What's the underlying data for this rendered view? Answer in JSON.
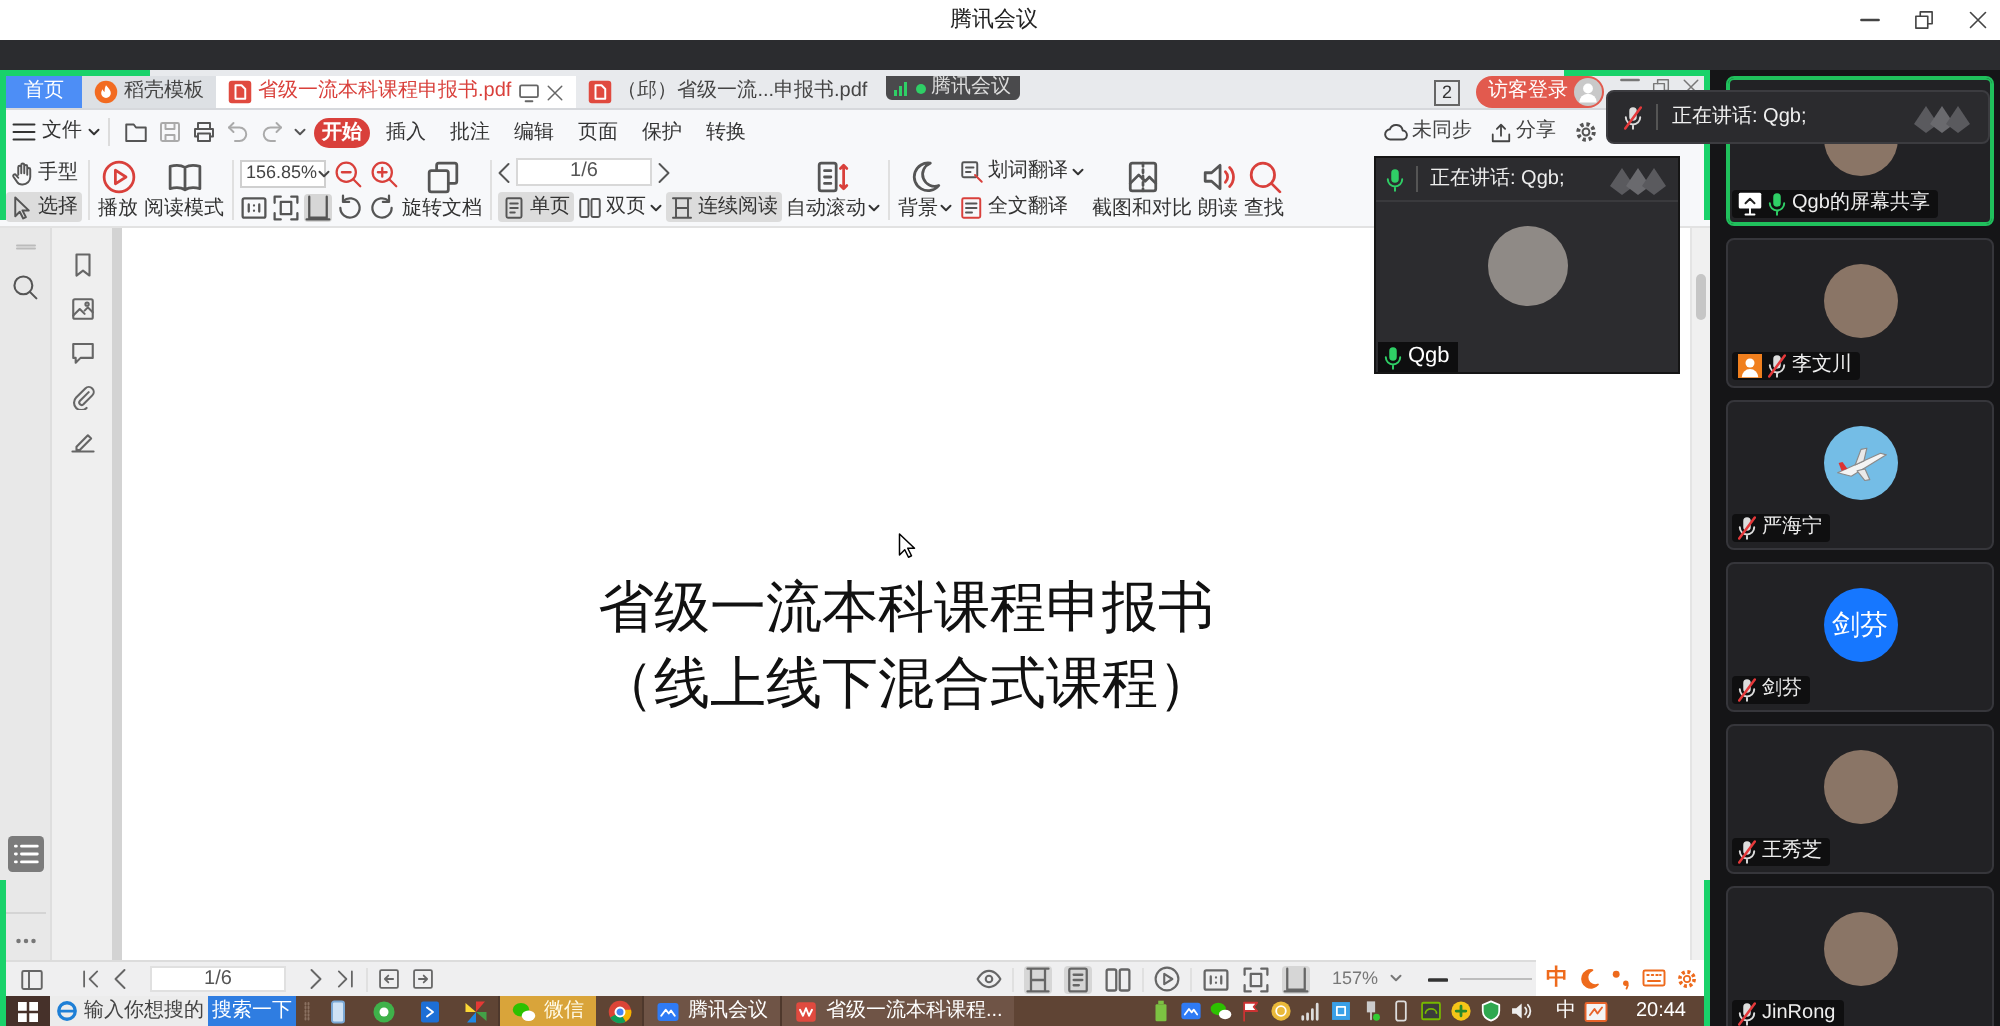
{
  "window": {
    "title": "腾讯会议"
  },
  "meeting_badge": {
    "label": "腾讯会议"
  },
  "wps": {
    "tabs": [
      {
        "kind": "home",
        "label": "首页",
        "selected": false
      },
      {
        "kind": "template",
        "label": "稻壳模板",
        "selected": false
      },
      {
        "kind": "pdf",
        "label": "省级一流本科课程申报书.pdf",
        "selected": true
      },
      {
        "kind": "pdf",
        "label": "（邱）省级一流...申报书.pdf",
        "selected": false
      }
    ],
    "window_count": "2",
    "login": "访客登录",
    "file_menu": "文件",
    "ribbon_tabs": [
      {
        "label": "开始",
        "selected": true
      },
      {
        "label": "插入",
        "selected": false
      },
      {
        "label": "批注",
        "selected": false
      },
      {
        "label": "编辑",
        "selected": false
      },
      {
        "label": "页面",
        "selected": false
      },
      {
        "label": "保护",
        "selected": false
      },
      {
        "label": "转换",
        "selected": false
      }
    ],
    "sync": "未同步",
    "share": "分享",
    "tools": {
      "hand": {
        "label": "手型",
        "selected": false
      },
      "select": {
        "label": "选择",
        "selected": true
      },
      "play": "播放",
      "read_mode": "阅读模式",
      "zoom": "156.85%",
      "fit_modes": [
        {
          "kind": "actual",
          "selected": false
        },
        {
          "kind": "fit-page",
          "selected": false
        },
        {
          "kind": "fit-width",
          "selected": true
        }
      ],
      "rotate": "旋转文档",
      "page": "1/6",
      "page_modes": [
        {
          "kind": "single",
          "label": "单页",
          "selected": true,
          "dropdown": false
        },
        {
          "kind": "double",
          "label": "双页",
          "selected": false,
          "dropdown": true
        },
        {
          "kind": "continuous",
          "label": "连续阅读",
          "selected": true,
          "dropdown": false
        }
      ],
      "auto_scroll": "自动滚动",
      "background": "背景",
      "word_translate": "划词翻译",
      "full_translate": "全文翻译",
      "screenshot_compare": "截图和对比",
      "read_aloud": "朗读",
      "find": "查找"
    },
    "document": {
      "title": "省级一流本科课程申报书",
      "subtitle": "（线上线下混合式课程）"
    },
    "status_bar": {
      "page": "1/6",
      "view_modes": [
        {
          "kind": "continuous",
          "selected": true
        },
        {
          "kind": "single",
          "selected": true
        },
        {
          "kind": "double",
          "selected": false
        }
      ],
      "fit_modes": [
        {
          "kind": "actual",
          "selected": false
        },
        {
          "kind": "fit-page",
          "selected": false
        },
        {
          "kind": "fit-width",
          "selected": true
        }
      ],
      "zoom": "157%"
    }
  },
  "ime": {
    "mode": "中"
  },
  "taskbar": {
    "search_placeholder": "输入你想搜的",
    "search_button": "搜索一下",
    "windows": [
      {
        "kind": "wechat",
        "label": "微信",
        "highlighted": true
      },
      {
        "kind": "meeting",
        "label": "腾讯会议",
        "highlighted": false
      },
      {
        "kind": "wps",
        "label": "省级一流本科课程...",
        "highlighted": false
      }
    ],
    "input_mode": "中",
    "clock": "20:44"
  },
  "video_inset": {
    "speaking": "正在讲话: Qgb;",
    "muted": false,
    "name": "Qgb",
    "name_muted": false
  },
  "speaker_banner": {
    "speaking": "正在讲话: Qgb;",
    "muted": true
  },
  "participants": [
    {
      "name": "Qgb的屏幕共享",
      "kind": "photo",
      "sharing": true,
      "host": false,
      "muted": false,
      "speaking": true
    },
    {
      "name": "李文川",
      "kind": "photo",
      "sharing": false,
      "host": true,
      "muted": true,
      "speaking": false
    },
    {
      "name": "严海宁",
      "kind": "plane",
      "sharing": false,
      "host": false,
      "muted": true,
      "speaking": false
    },
    {
      "name": "剑芬",
      "kind": "text",
      "avatar_text": "剑芬",
      "sharing": false,
      "host": false,
      "muted": true,
      "speaking": false
    },
    {
      "name": "王秀芝",
      "kind": "photo",
      "sharing": false,
      "host": false,
      "muted": true,
      "speaking": false
    },
    {
      "name": "JinRong",
      "kind": "photo",
      "sharing": false,
      "host": false,
      "muted": true,
      "speaking": false
    }
  ]
}
